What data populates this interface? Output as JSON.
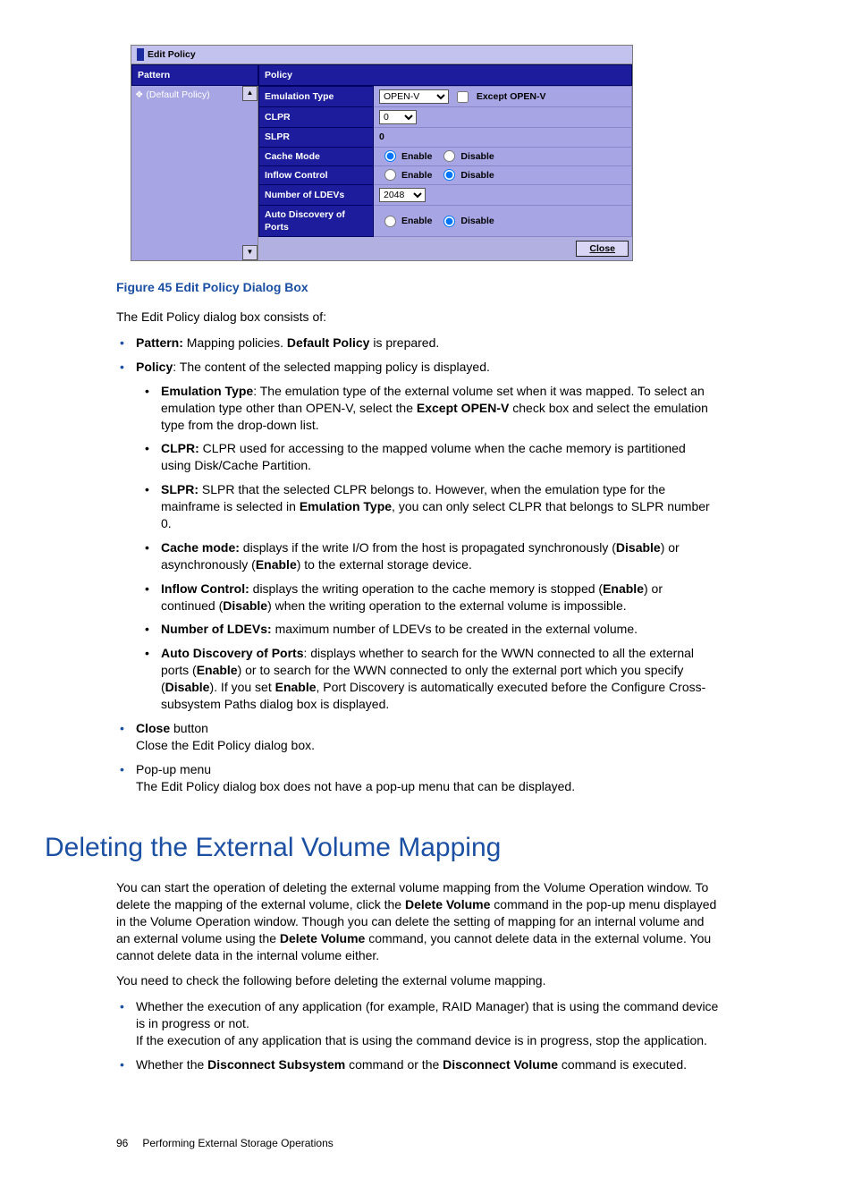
{
  "dialog": {
    "title": "Edit Policy",
    "pattern_header": "Pattern",
    "policy_header": "Policy",
    "pattern_item": "(Default Policy)",
    "close": "Close",
    "rows": {
      "emul_label": "Emulation Type",
      "emul_value": "OPEN-V",
      "emul_except": "Except OPEN-V",
      "clpr_label": "CLPR",
      "clpr_value": "0",
      "slpr_label": "SLPR",
      "slpr_value": "0",
      "cache_label": "Cache Mode",
      "inflow_label": "Inflow Control",
      "ldev_label": "Number of LDEVs",
      "ldev_value": "2048",
      "auto_label": "Auto Discovery of Ports",
      "enable": "Enable",
      "disable": "Disable"
    }
  },
  "caption": "Figure 45 Edit Policy Dialog Box",
  "intro": "The Edit Policy dialog box consists of:",
  "list1": {
    "pattern_b": "Pattern:",
    "pattern_t": " Mapping policies. ",
    "pattern_b2": "Default Policy",
    "pattern_t2": " is prepared.",
    "policy_b": "Policy",
    "policy_t": ": The content of the selected mapping policy is displayed.",
    "emul_b": "Emulation Type",
    "emul_t": ": The emulation type of the external volume set when it was mapped. To select an emulation type other than OPEN-V, select the ",
    "emul_b2": "Except OPEN-V",
    "emul_t2": " check box and select the emulation type from the drop-down list.",
    "clpr_b": "CLPR:",
    "clpr_t": " CLPR used for accessing to the mapped volume when the cache memory is partitioned using Disk/Cache Partition.",
    "slpr_b": "SLPR:",
    "slpr_t1": " SLPR that the selected CLPR belongs to. However, when the emulation type for the mainframe is selected in ",
    "slpr_b2": "Emulation Type",
    "slpr_t2": ", you can only select CLPR that belongs to SLPR number 0.",
    "cache_b": "Cache mode:",
    "cache_t1": " displays if the write I/O from the host is propagated synchronously (",
    "cache_b2": "Disable",
    "cache_t2": ") or asynchronously (",
    "cache_b3": "Enable",
    "cache_t3": ") to the external storage device.",
    "inflow_b": "Inflow Control:",
    "inflow_t1": " displays the writing operation to the cache memory is stopped (",
    "inflow_b2": "Enable",
    "inflow_t2": ") or continued (",
    "inflow_b3": "Disable",
    "inflow_t3": ") when the writing operation to the external volume is impossible.",
    "ldev_b": "Number of LDEVs:",
    "ldev_t": " maximum number of LDEVs to be created in the external volume.",
    "auto_b": "Auto Discovery of Ports",
    "auto_t1": ": displays whether to search for the WWN connected to all the external ports (",
    "auto_b2": "Enable",
    "auto_t2": ") or to search for the WWN connected to only the external port which you specify (",
    "auto_b3": "Disable",
    "auto_t3": "). If you set ",
    "auto_b4": "Enable",
    "auto_t4": ", Port Discovery is automatically executed before the Configure Cross-subsystem Paths dialog box is displayed.",
    "close_b": "Close",
    "close_t1": " button",
    "close_t2": "Close the Edit Policy dialog box.",
    "popup_t1": "Pop-up menu",
    "popup_t2": "The Edit Policy dialog box does not have a pop-up menu that can be displayed."
  },
  "h1": "Deleting the External Volume Mapping",
  "del": {
    "p1a": "You can start the operation of deleting the external volume mapping from the Volume Operation window. To delete the mapping of the external volume, click the ",
    "p1b": "Delete Volume",
    "p1c": " command in the pop-up menu displayed in the Volume Operation window. Though you can delete the setting of mapping for an internal volume and an external volume using the ",
    "p1d": "Delete Volume",
    "p1e": " command, you cannot delete data in the external volume. You cannot delete data in the internal volume either.",
    "p2": "You need to check the following before deleting the external volume mapping.",
    "li1a": "Whether the execution of any application (for example, RAID Manager) that is using the command device is in progress or not.",
    "li1b": "If the execution of any application that is using the command device is in progress, stop the application.",
    "li2a": "Whether the ",
    "li2b": "Disconnect Subsystem",
    "li2c": " command or the ",
    "li2d": "Disconnect Volume",
    "li2e": " command is executed."
  },
  "footer": {
    "page": "96",
    "title": "Performing External Storage Operations"
  }
}
